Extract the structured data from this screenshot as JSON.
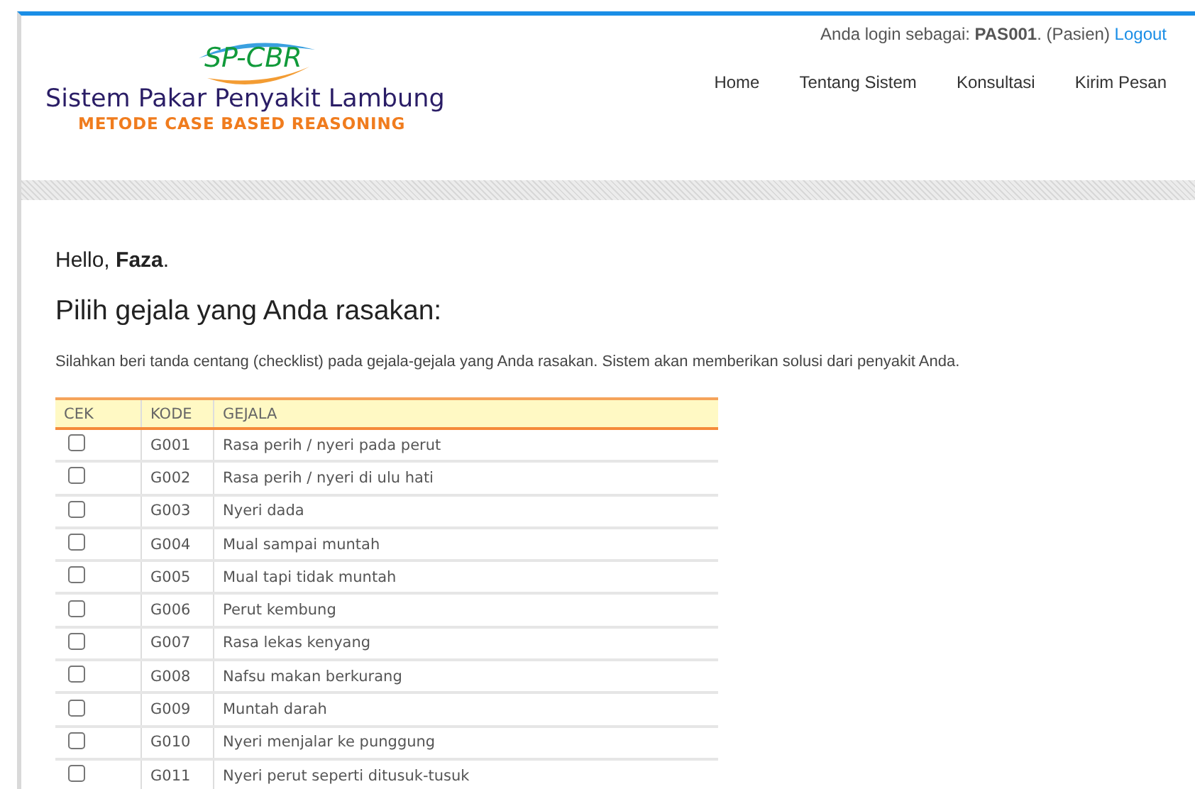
{
  "header": {
    "logo": {
      "mark": "SP-CBR",
      "title": "Sistem Pakar Penyakit Lambung",
      "subtitle": "METODE CASE BASED REASONING"
    },
    "login": {
      "text": "Anda login sebagai: **PAS001**. (Pasien)",
      "link": "Logout"
    },
    "nav": [
      "Home",
      "Tentang Sistem",
      "Konsultasi",
      "Kirim Pesan"
    ]
  },
  "greeting": "Hello, **Faza**.",
  "heading": "Pilih gejala yang Anda rasakan:",
  "instruction": "Silahkan beri tanda centang (checklist) pada gejala-gejala yang Anda rasakan. Sistem akan memberikan solusi dari penyakit Anda.",
  "table": {
    "columns": [
      "CEK",
      "KODE",
      "GEJALA"
    ],
    "rows": [
      {
        "code": "G001",
        "symptom": "Rasa perih / nyeri pada perut",
        "checked": false
      },
      {
        "code": "G002",
        "symptom": "Rasa perih / nyeri di ulu hati",
        "checked": false
      },
      {
        "code": "G003",
        "symptom": "Nyeri dada",
        "checked": false
      },
      {
        "code": "G004",
        "symptom": "Mual sampai muntah",
        "checked": false
      },
      {
        "code": "G005",
        "symptom": "Mual tapi tidak muntah",
        "checked": false
      },
      {
        "code": "G006",
        "symptom": "Perut kembung",
        "checked": false
      },
      {
        "code": "G007",
        "symptom": "Rasa lekas kenyang",
        "checked": false
      },
      {
        "code": "G008",
        "symptom": "Nafsu makan berkurang",
        "checked": false
      },
      {
        "code": "G009",
        "symptom": "Muntah darah",
        "checked": false
      },
      {
        "code": "G010",
        "symptom": "Nyeri menjalar ke punggung",
        "checked": false
      },
      {
        "code": "G011",
        "symptom": "Nyeri perut seperti ditusuk-tusuk",
        "checked": false
      }
    ]
  }
}
